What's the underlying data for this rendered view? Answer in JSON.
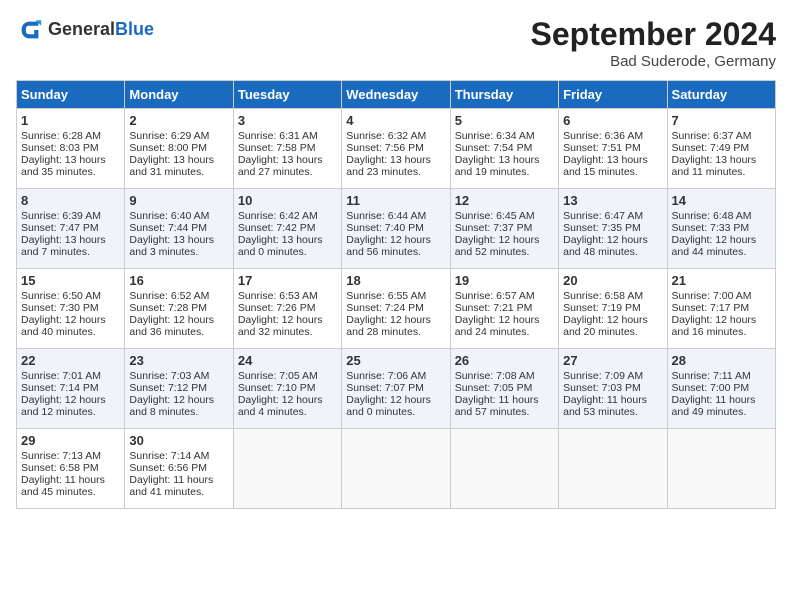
{
  "header": {
    "logo_general": "General",
    "logo_blue": "Blue",
    "month_title": "September 2024",
    "location": "Bad Suderode, Germany"
  },
  "days_of_week": [
    "Sunday",
    "Monday",
    "Tuesday",
    "Wednesday",
    "Thursday",
    "Friday",
    "Saturday"
  ],
  "weeks": [
    [
      {
        "day": 1,
        "rise": "6:28 AM",
        "set": "8:03 PM",
        "daylight": "13 hours and 35 minutes."
      },
      {
        "day": 2,
        "rise": "6:29 AM",
        "set": "8:00 PM",
        "daylight": "13 hours and 31 minutes."
      },
      {
        "day": 3,
        "rise": "6:31 AM",
        "set": "7:58 PM",
        "daylight": "13 hours and 27 minutes."
      },
      {
        "day": 4,
        "rise": "6:32 AM",
        "set": "7:56 PM",
        "daylight": "13 hours and 23 minutes."
      },
      {
        "day": 5,
        "rise": "6:34 AM",
        "set": "7:54 PM",
        "daylight": "13 hours and 19 minutes."
      },
      {
        "day": 6,
        "rise": "6:36 AM",
        "set": "7:51 PM",
        "daylight": "13 hours and 15 minutes."
      },
      {
        "day": 7,
        "rise": "6:37 AM",
        "set": "7:49 PM",
        "daylight": "13 hours and 11 minutes."
      }
    ],
    [
      {
        "day": 8,
        "rise": "6:39 AM",
        "set": "7:47 PM",
        "daylight": "13 hours and 7 minutes."
      },
      {
        "day": 9,
        "rise": "6:40 AM",
        "set": "7:44 PM",
        "daylight": "13 hours and 3 minutes."
      },
      {
        "day": 10,
        "rise": "6:42 AM",
        "set": "7:42 PM",
        "daylight": "13 hours and 0 minutes."
      },
      {
        "day": 11,
        "rise": "6:44 AM",
        "set": "7:40 PM",
        "daylight": "12 hours and 56 minutes."
      },
      {
        "day": 12,
        "rise": "6:45 AM",
        "set": "7:37 PM",
        "daylight": "12 hours and 52 minutes."
      },
      {
        "day": 13,
        "rise": "6:47 AM",
        "set": "7:35 PM",
        "daylight": "12 hours and 48 minutes."
      },
      {
        "day": 14,
        "rise": "6:48 AM",
        "set": "7:33 PM",
        "daylight": "12 hours and 44 minutes."
      }
    ],
    [
      {
        "day": 15,
        "rise": "6:50 AM",
        "set": "7:30 PM",
        "daylight": "12 hours and 40 minutes."
      },
      {
        "day": 16,
        "rise": "6:52 AM",
        "set": "7:28 PM",
        "daylight": "12 hours and 36 minutes."
      },
      {
        "day": 17,
        "rise": "6:53 AM",
        "set": "7:26 PM",
        "daylight": "12 hours and 32 minutes."
      },
      {
        "day": 18,
        "rise": "6:55 AM",
        "set": "7:24 PM",
        "daylight": "12 hours and 28 minutes."
      },
      {
        "day": 19,
        "rise": "6:57 AM",
        "set": "7:21 PM",
        "daylight": "12 hours and 24 minutes."
      },
      {
        "day": 20,
        "rise": "6:58 AM",
        "set": "7:19 PM",
        "daylight": "12 hours and 20 minutes."
      },
      {
        "day": 21,
        "rise": "7:00 AM",
        "set": "7:17 PM",
        "daylight": "12 hours and 16 minutes."
      }
    ],
    [
      {
        "day": 22,
        "rise": "7:01 AM",
        "set": "7:14 PM",
        "daylight": "12 hours and 12 minutes."
      },
      {
        "day": 23,
        "rise": "7:03 AM",
        "set": "7:12 PM",
        "daylight": "12 hours and 8 minutes."
      },
      {
        "day": 24,
        "rise": "7:05 AM",
        "set": "7:10 PM",
        "daylight": "12 hours and 4 minutes."
      },
      {
        "day": 25,
        "rise": "7:06 AM",
        "set": "7:07 PM",
        "daylight": "12 hours and 0 minutes."
      },
      {
        "day": 26,
        "rise": "7:08 AM",
        "set": "7:05 PM",
        "daylight": "11 hours and 57 minutes."
      },
      {
        "day": 27,
        "rise": "7:09 AM",
        "set": "7:03 PM",
        "daylight": "11 hours and 53 minutes."
      },
      {
        "day": 28,
        "rise": "7:11 AM",
        "set": "7:00 PM",
        "daylight": "11 hours and 49 minutes."
      }
    ],
    [
      {
        "day": 29,
        "rise": "7:13 AM",
        "set": "6:58 PM",
        "daylight": "11 hours and 45 minutes."
      },
      {
        "day": 30,
        "rise": "7:14 AM",
        "set": "6:56 PM",
        "daylight": "11 hours and 41 minutes."
      },
      null,
      null,
      null,
      null,
      null
    ]
  ]
}
